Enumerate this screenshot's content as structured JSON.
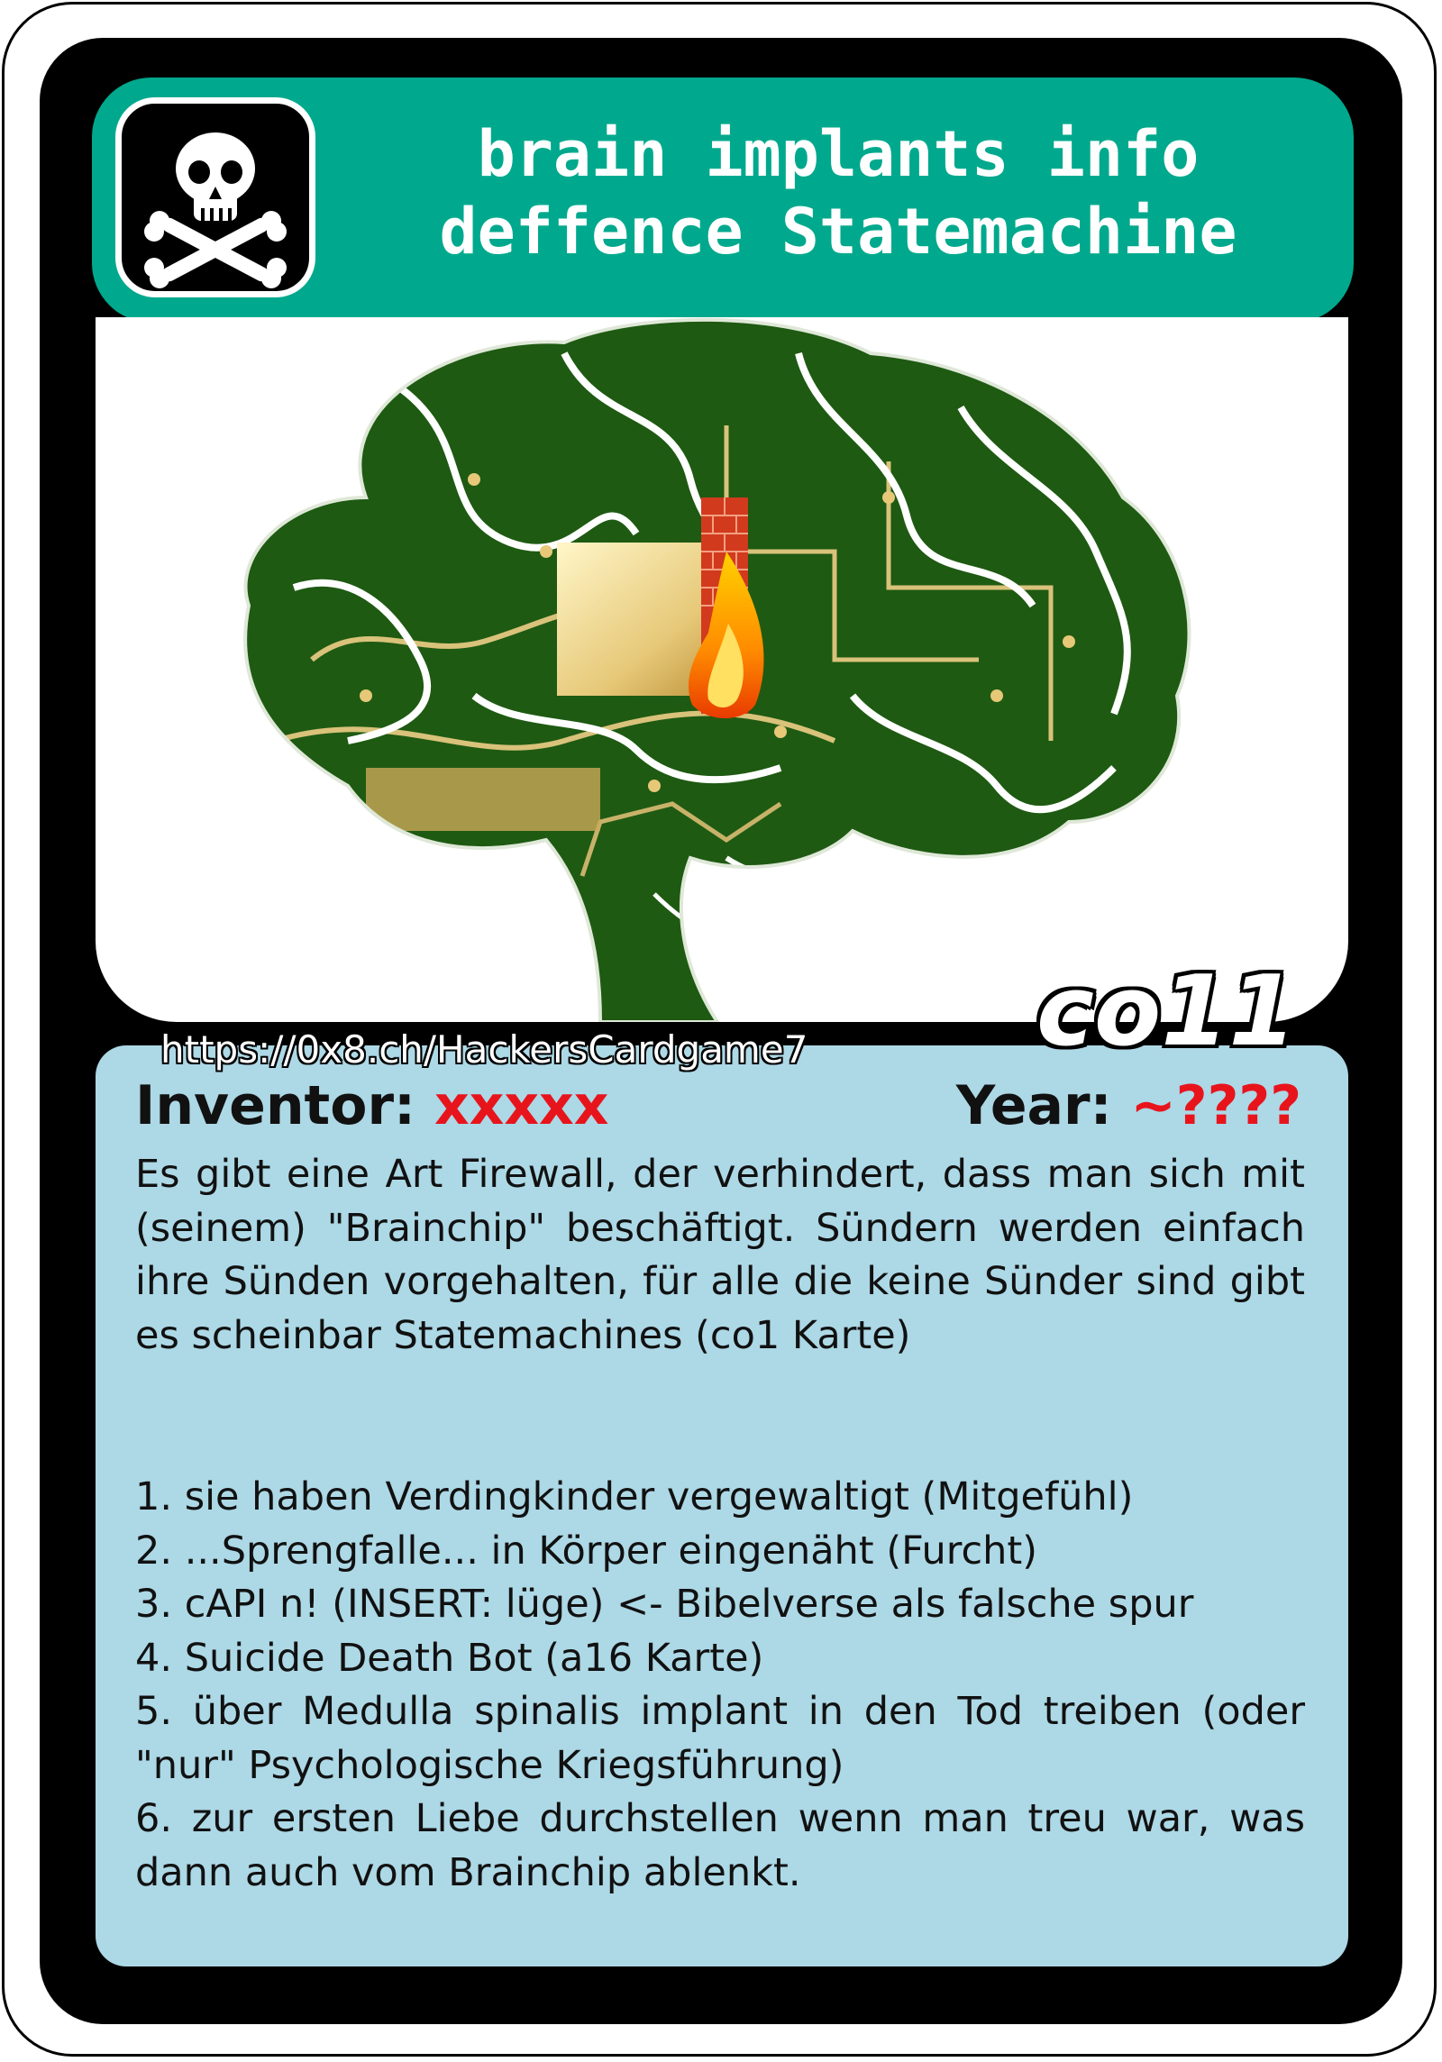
{
  "card": {
    "title_line1": "brain implants info",
    "title_line2": "deffence Statemachine",
    "url": "https://0x8.ch/HackersCardgame7",
    "code": "co11",
    "inventor_label": "Inventor:",
    "inventor_value": "xxxxx",
    "year_label": "Year:",
    "year_value": "~????",
    "description": "Es gibt eine Art Firewall, der verhindert, dass man sich mit (seinem) \"Brainchip\" beschäftigt. Sündern werden einfach ihre Sünden vorgehalten, für alle die keine Sünder sind gibt es scheinbar Statemachines (co1 Karte)",
    "list": [
      "1. sie haben Verdingkinder vergewaltigt (Mitgefühl)",
      "2. ...Sprengfalle... in Körper eingenäht (Furcht)",
      "3. cAPI n! (INSERT: lüge) <- Bibelverse als falsche spur",
      "4. Suicide Death Bot (a16 Karte)",
      "5. über Medulla spinalis implant in den Tod treiben (oder \"nur\" Psychologische Kriegsführung)",
      "6. zur ersten Liebe durchstellen wenn man treu war, was dann auch vom Brainchip ablenkt."
    ]
  },
  "icons": {
    "header_icon": "skull-crossbones-icon",
    "illustration": "circuit-brain-firewall"
  },
  "colors": {
    "header": "#00a98d",
    "text_panel": "#add8e6",
    "accent_red": "#e8141c",
    "circuit_green": "#1e5a12"
  }
}
